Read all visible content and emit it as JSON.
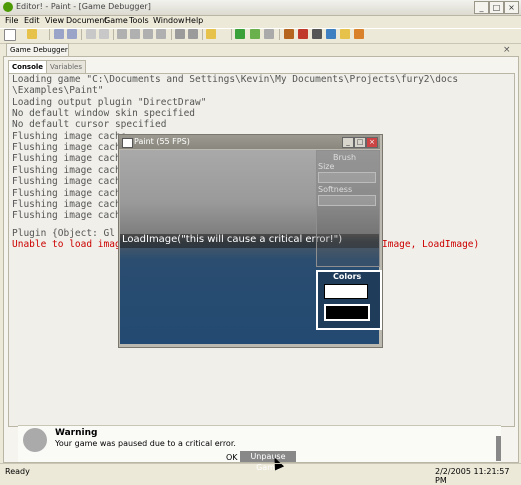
{
  "window": {
    "title": "Editor! - Paint - [Game Debugger]",
    "btn_min": "_",
    "btn_max": "□",
    "btn_close": "×"
  },
  "menu": [
    "File",
    "Edit",
    "View",
    "Document",
    "Game",
    "Tools",
    "Window",
    "Help"
  ],
  "panel": {
    "tab_label": "Game Debugger",
    "close_glyph": "×",
    "subtabs": [
      "Console",
      "Variables"
    ]
  },
  "console_lines": [
    "Loading game \"C:\\Documents and Settings\\Kevin\\My Documents\\Projects\\fury2\\docs",
    "\\Examples\\Paint\"",
    "Loading output plugin \"DirectDraw\"",
    "No default window skin specified",
    "No default cursor specified",
    "Flushing image cache",
    "Flushing image cach",
    "Flushing image cach",
    "Flushing image cach",
    "Flushing image cach",
    "Flushing image cach",
    "Flushing image cach",
    "Flushing image cach",
    "Plugin {Object: Gl"
  ],
  "console_error": {
    "left": "Unable to load imag",
    "right": "Image, LoadImage)"
  },
  "paint": {
    "title": "Paint (55 FPS)",
    "overlay_text": "LoadImage(\"this will cause a critical error!\")",
    "brush": "Brush",
    "size": "Size",
    "softness": "Softness",
    "colors": "Colors",
    "color_primary": "#ffffff",
    "color_secondary": "#000000"
  },
  "warning": {
    "title": "Warning",
    "message": "Your game was paused due to a critical error.",
    "ok": "OK",
    "unpause": "Unpause Game"
  },
  "status": {
    "ready": "Ready",
    "datetime": "2/2/2005 11:21:57 PM"
  }
}
